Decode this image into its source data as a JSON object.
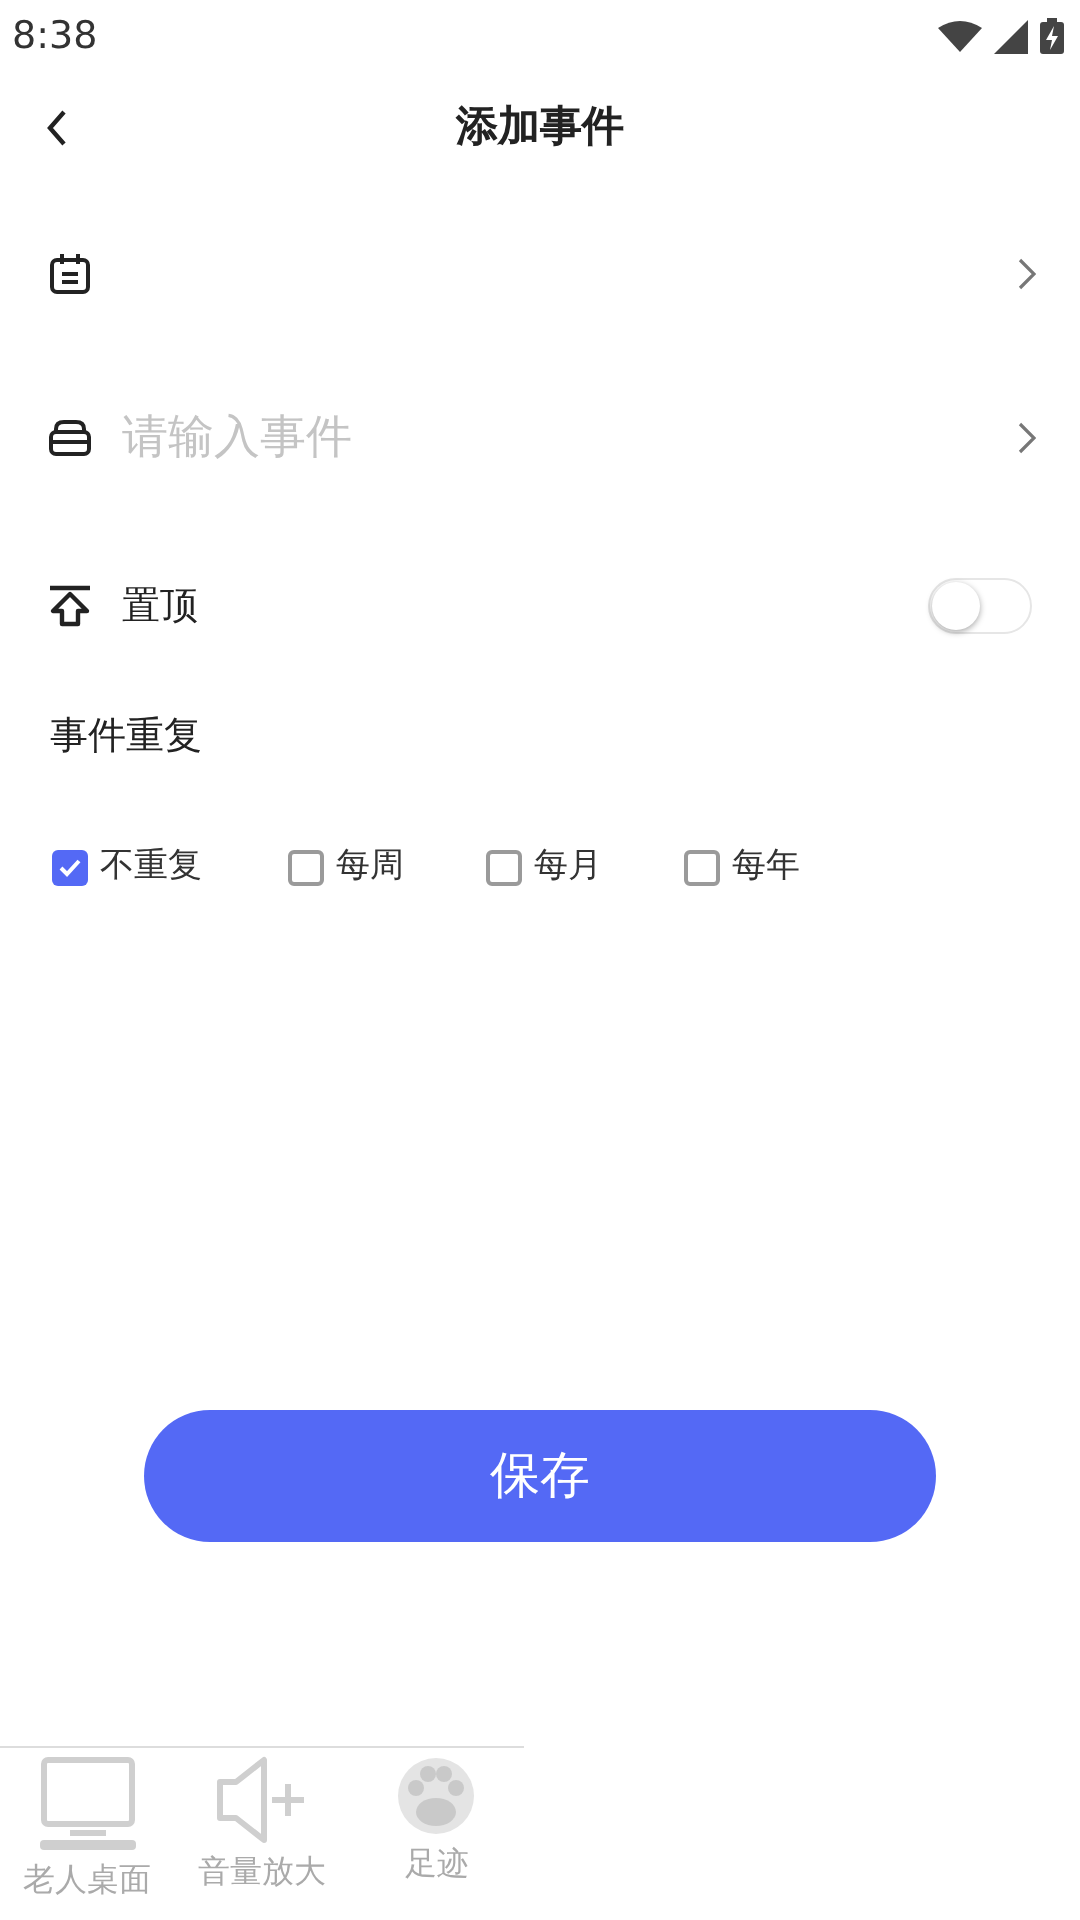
{
  "status_bar": {
    "time": "8:38"
  },
  "header": {
    "title": "添加事件"
  },
  "rows": [
    {
      "kind": "date"
    },
    {
      "kind": "event",
      "placeholder": "请输入事件"
    }
  ],
  "pin": {
    "label": "置顶",
    "on": false
  },
  "repeat": {
    "label": "事件重复",
    "options": [
      {
        "label": "不重复",
        "checked": true
      },
      {
        "label": "每周",
        "checked": false
      },
      {
        "label": "每月",
        "checked": false
      },
      {
        "label": "每年",
        "checked": false
      }
    ]
  },
  "save_button": "保存",
  "bottom_nav": [
    {
      "label": "老人桌面",
      "kind": "desktop"
    },
    {
      "label": "音量放大",
      "kind": "volume"
    },
    {
      "label": "足迹",
      "kind": "paw"
    }
  ]
}
